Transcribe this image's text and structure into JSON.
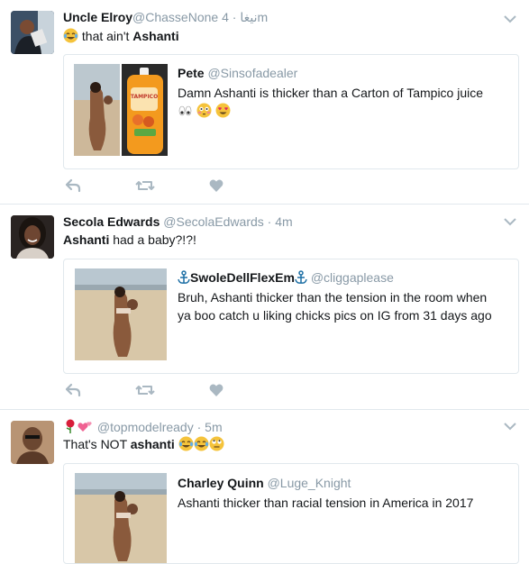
{
  "tweets": [
    {
      "name": "Uncle Elroy",
      "handle": "@ChasseNone",
      "handle_suffix": " نيغا",
      "time": "4m",
      "text_parts": {
        "pre": " that ain't ",
        "bold": "Ashanti",
        "post": ""
      },
      "quote": {
        "name": "Pete",
        "handle": "@Sinsofadealer",
        "text_line1": "Damn Ashanti is thicker than a Carton of Tampico juice",
        "jug_label": "TAMPICO"
      }
    },
    {
      "name": "Secola Edwards",
      "handle": "@SecolaEdwards",
      "time": "4m",
      "text_parts": {
        "pre": "",
        "bold": "Ashanti",
        "post": " had a baby?!?!"
      },
      "quote": {
        "name": "SwoleDellFlexEm",
        "handle": "@cliggaplease",
        "text_line1": "Bruh, Ashanti thicker than the tension in the room when",
        "text_line2": "ya boo catch u liking chicks pics on IG from 31 days ago"
      }
    },
    {
      "name": "",
      "handle": "@topmodelready",
      "time": "5m",
      "text_parts": {
        "pre": "That's NOT ",
        "bold": "ashanti",
        "post": " "
      },
      "quote": {
        "name": "Charley Quinn",
        "handle": "@Luge_Knight",
        "text_line1": "Ashanti thicker than racial tension in America in 2017"
      }
    }
  ],
  "separator": " · ",
  "icons": [
    "reply-icon",
    "retweet-icon",
    "like-icon",
    "chevron-down-icon",
    "anchor-icon",
    "rose-icon",
    "hearts-icon"
  ],
  "colors": {
    "muted": "#8899a6",
    "border": "#e1e8ed",
    "icon": "#aab8c2"
  }
}
